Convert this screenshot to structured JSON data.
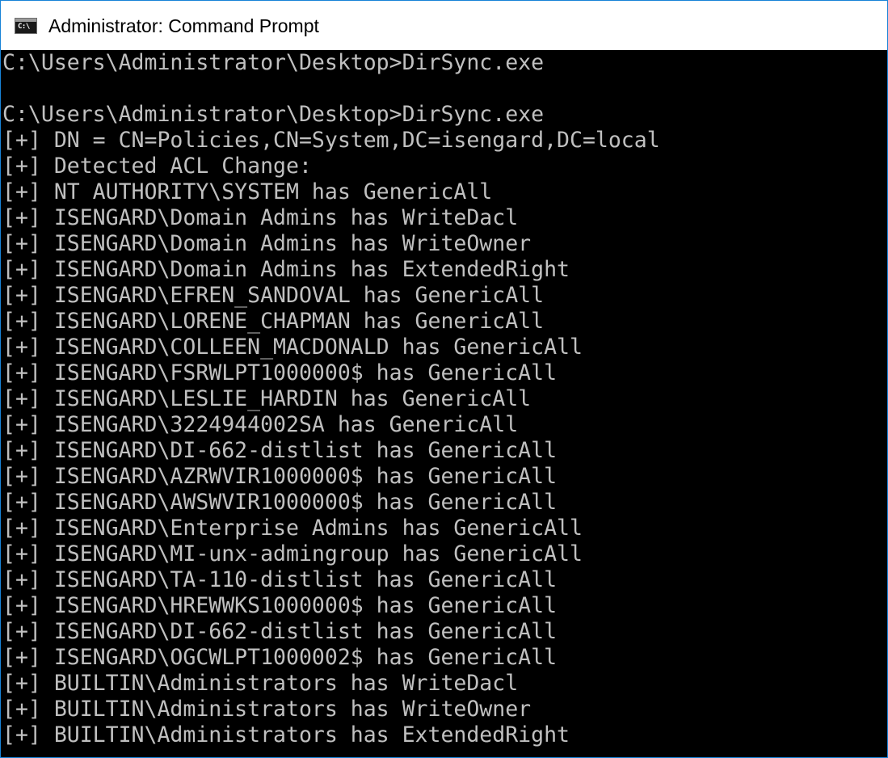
{
  "window": {
    "title": "Administrator: Command Prompt",
    "icon_name": "cmd-console-icon",
    "icon_glyph": "C:\\",
    "border_color": "#1883d7",
    "background": "#000000",
    "text_color": "#c0c0c0"
  },
  "console": {
    "lines": [
      "C:\\Users\\Administrator\\Desktop>DirSync.exe",
      "",
      "C:\\Users\\Administrator\\Desktop>DirSync.exe",
      "[+] DN = CN=Policies,CN=System,DC=isengard,DC=local",
      "[+] Detected ACL Change:",
      "[+] NT AUTHORITY\\SYSTEM has GenericAll",
      "[+] ISENGARD\\Domain Admins has WriteDacl",
      "[+] ISENGARD\\Domain Admins has WriteOwner",
      "[+] ISENGARD\\Domain Admins has ExtendedRight",
      "[+] ISENGARD\\EFREN_SANDOVAL has GenericAll",
      "[+] ISENGARD\\LORENE_CHAPMAN has GenericAll",
      "[+] ISENGARD\\COLLEEN_MACDONALD has GenericAll",
      "[+] ISENGARD\\FSRWLPT1000000$ has GenericAll",
      "[+] ISENGARD\\LESLIE_HARDIN has GenericAll",
      "[+] ISENGARD\\3224944002SA has GenericAll",
      "[+] ISENGARD\\DI-662-distlist has GenericAll",
      "[+] ISENGARD\\AZRWVIR1000000$ has GenericAll",
      "[+] ISENGARD\\AWSWVIR1000000$ has GenericAll",
      "[+] ISENGARD\\Enterprise Admins has GenericAll",
      "[+] ISENGARD\\MI-unx-admingroup has GenericAll",
      "[+] ISENGARD\\TA-110-distlist has GenericAll",
      "[+] ISENGARD\\HREWWKS1000000$ has GenericAll",
      "[+] ISENGARD\\DI-662-distlist has GenericAll",
      "[+] ISENGARD\\OGCWLPT1000002$ has GenericAll",
      "[+] BUILTIN\\Administrators has WriteDacl",
      "[+] BUILTIN\\Administrators has WriteOwner",
      "[+] BUILTIN\\Administrators has ExtendedRight"
    ]
  }
}
